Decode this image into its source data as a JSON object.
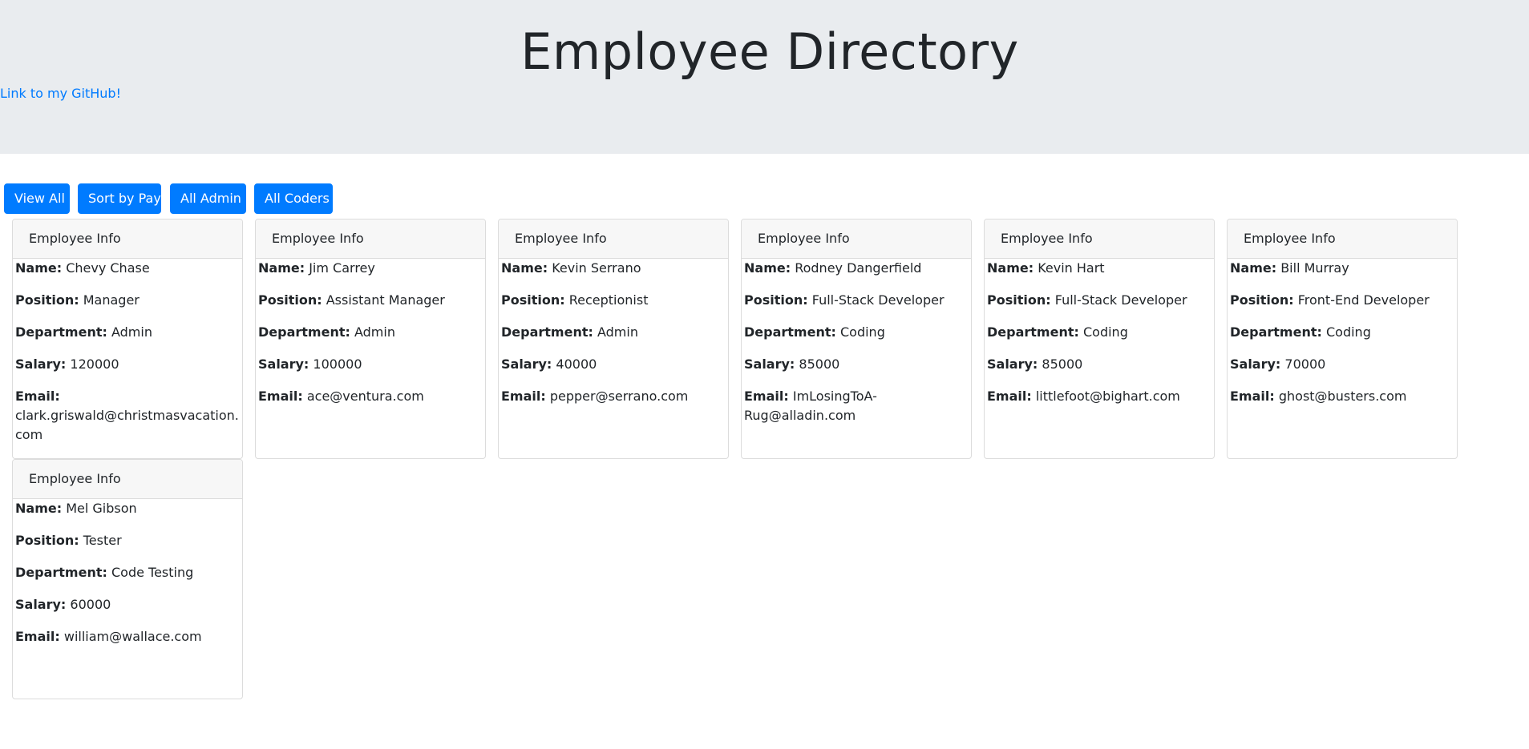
{
  "header": {
    "title": "Employee Directory",
    "github_link": "Link to my GitHub!"
  },
  "buttons": {
    "view_all": "View All",
    "sort_by_pay": "Sort by Pay",
    "all_admin": "All Admin",
    "all_coders": "All Coders"
  },
  "labels": {
    "card_header": "Employee Info",
    "name": "Name:",
    "position": "Position:",
    "department": "Department:",
    "salary": "Salary:",
    "email": "Email:"
  },
  "employees": [
    {
      "name": "Chevy Chase",
      "position": "Manager",
      "department": "Admin",
      "salary": "120000",
      "email": "clark.griswald@christmasvacation.com"
    },
    {
      "name": "Jim Carrey",
      "position": "Assistant Manager",
      "department": "Admin",
      "salary": "100000",
      "email": "ace@ventura.com"
    },
    {
      "name": "Kevin Serrano",
      "position": "Receptionist",
      "department": "Admin",
      "salary": "40000",
      "email": "pepper@serrano.com"
    },
    {
      "name": "Rodney Dangerfield",
      "position": "Full-Stack Developer",
      "department": "Coding",
      "salary": "85000",
      "email": "ImLosingToA-Rug@alladin.com"
    },
    {
      "name": "Kevin Hart",
      "position": "Full-Stack Developer",
      "department": "Coding",
      "salary": "85000",
      "email": "littlefoot@bighart.com"
    },
    {
      "name": "Bill Murray",
      "position": "Front-End Developer",
      "department": "Coding",
      "salary": "70000",
      "email": "ghost@busters.com"
    },
    {
      "name": "Mel Gibson",
      "position": "Tester",
      "department": "Code Testing",
      "salary": "60000",
      "email": "william@wallace.com"
    }
  ]
}
